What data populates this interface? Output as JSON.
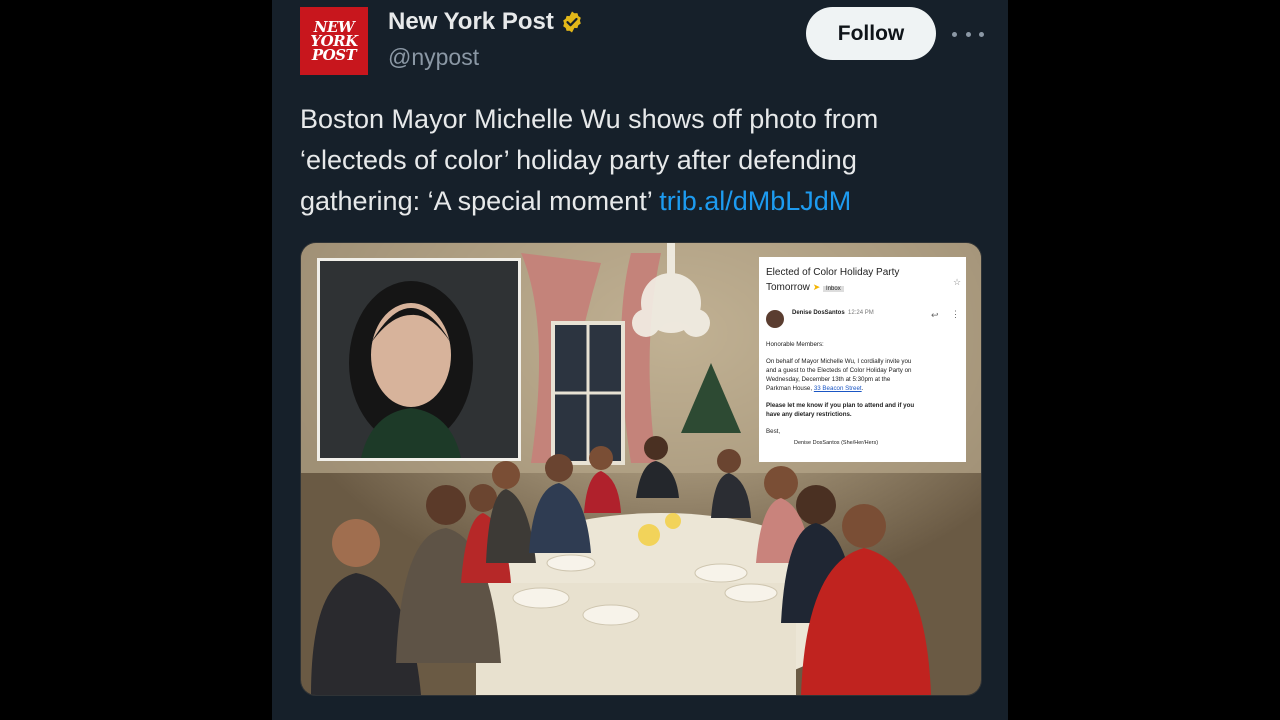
{
  "account": {
    "logo_text": "NEW\nYORK\nPOST",
    "name": "New York Post",
    "handle": "@nypost",
    "verified_color": "#e2b719",
    "brand_color": "#c8161d"
  },
  "actions": {
    "follow_label": "Follow",
    "more_icon": "more-horizontal-icon"
  },
  "tweet": {
    "text_line1": "Boston Mayor Michelle Wu shows off photo from",
    "text_line2": "‘electeds of color’ holiday party after defending",
    "text_line3": "gathering: ‘A special moment’",
    "link": "trib.al/dMbLJdM",
    "link_color": "#1d9bf0"
  },
  "media": {
    "email": {
      "subject_line1": "Elected of Color Holiday Party",
      "subject_line2": "Tomorrow",
      "inbox_tag": "Inbox",
      "sender": "Denise DosSantos",
      "time": "12:24 PM",
      "greeting": "Honorable Members:",
      "body_line1": "On behalf of Mayor Michelle Wu, I cordially invite you",
      "body_line2": "and a guest to the Electeds of Color Holiday Party on",
      "body_line3": "Wednesday, December 13th at 5:30pm at the",
      "body_line4": "Parkman House,",
      "body_link": "33 Beacon Street",
      "body_end": ".",
      "bold_line1": "Please let me know if you plan to attend and if you",
      "bold_line2": "have any dietary restrictions.",
      "signoff": "Best,",
      "signature": "Denise DosSantos (She/Her/Hers)"
    }
  }
}
